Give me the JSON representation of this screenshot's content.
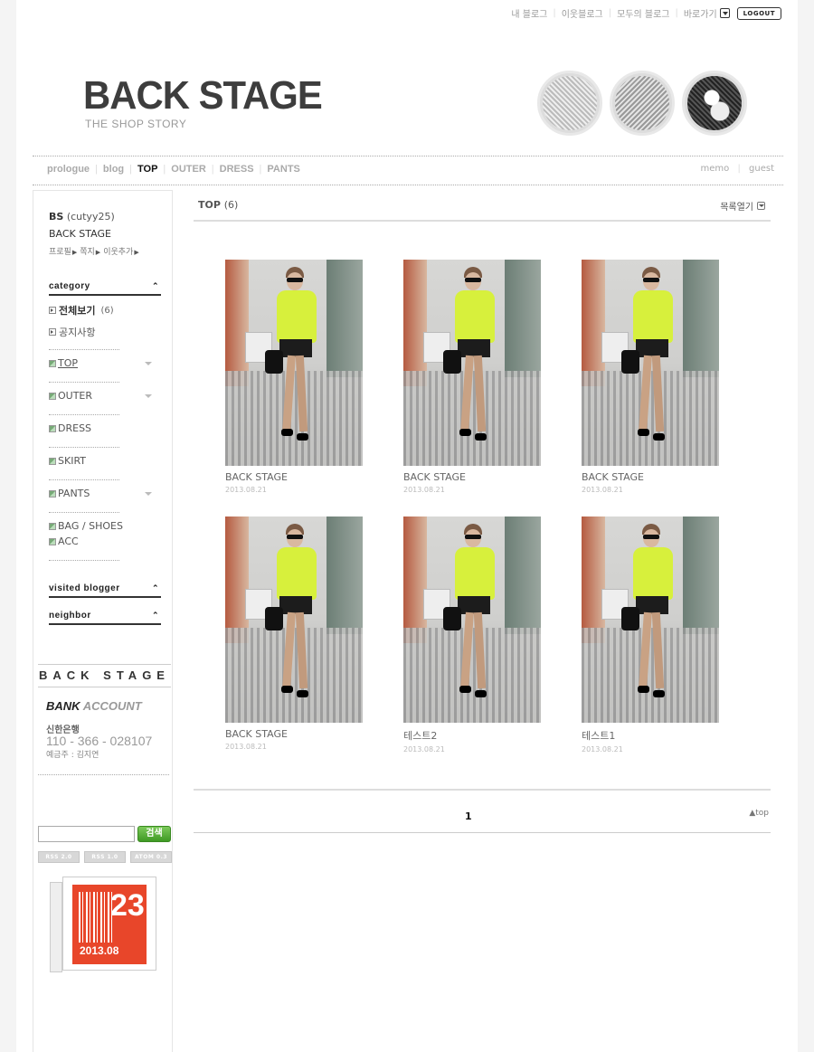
{
  "util": {
    "links": [
      "내 블로그",
      "이웃블로그",
      "모두의 블로그",
      "바로가기"
    ],
    "logout": "LOGOUT"
  },
  "logo": {
    "title": "BACK STAGE",
    "subtitle": "THE SHOP STORY"
  },
  "nav": {
    "items": [
      {
        "label": "prologue",
        "active": false
      },
      {
        "label": "blog",
        "active": false
      },
      {
        "label": "TOP",
        "active": true
      },
      {
        "label": "OUTER",
        "active": false
      },
      {
        "label": "DRESS",
        "active": false
      },
      {
        "label": "PANTS",
        "active": false
      }
    ],
    "right": [
      "memo",
      "guest"
    ]
  },
  "profile": {
    "nick": "BS",
    "id": "(cutyy25)",
    "blog_name": "BACK STAGE",
    "links": [
      "프로필",
      "쪽지",
      "이웃추가"
    ]
  },
  "sidebar": {
    "category_title": "category",
    "all": {
      "label": "전체보기",
      "count": "(6)"
    },
    "notice": "공지사항",
    "categories": [
      "TOP",
      "OUTER",
      "DRESS",
      "SKIRT",
      "PANTS",
      "BAG / SHOES",
      "ACC"
    ],
    "visited_title": "visited blogger",
    "neighbor_title": "neighbor",
    "backstage": "BACK STAGE",
    "bank": {
      "title_bold": "BANK",
      "title_light": "ACCOUNT",
      "bank_name": "신한은행",
      "number": "110 - 366 - 028107",
      "holder": "예금주 : 김지연"
    },
    "search_button": "검색",
    "feeds": [
      "RSS 2.0",
      "RSS 1.0",
      "ATOM 0.3"
    ],
    "badge": {
      "number": "23",
      "date": "2013.08"
    }
  },
  "main": {
    "title": "TOP",
    "count": "(6)",
    "list_open": "목록열기",
    "posts": [
      {
        "title": "BACK STAGE",
        "date": "2013.08.21"
      },
      {
        "title": "BACK STAGE",
        "date": "2013.08.21"
      },
      {
        "title": "BACK STAGE",
        "date": "2013.08.21"
      },
      {
        "title": "BACK STAGE",
        "date": "2013.08.21"
      },
      {
        "title": "테스트2",
        "date": "2013.08.21"
      },
      {
        "title": "테스트1",
        "date": "2013.08.21"
      }
    ],
    "page": "1",
    "to_top": "top"
  }
}
